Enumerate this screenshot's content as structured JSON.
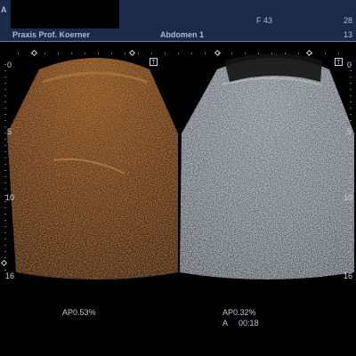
{
  "header": {
    "left_letter": "A",
    "practice": "Praxis Prof. Koerner",
    "exam": "Abdomen 1",
    "freq": "F 43",
    "right_top": "28",
    "right_bottom": "13"
  },
  "scales": {
    "left": [
      "0",
      "5",
      "10",
      "16"
    ],
    "right": [
      "0",
      "5",
      "10",
      "16"
    ]
  },
  "markers": {
    "t_left": "T",
    "t_right": "T"
  },
  "footer": {
    "left_ap": "AP0.53%",
    "right_ap": "AP0.32%",
    "time_label": "A",
    "time_value": "00:18"
  },
  "colors": {
    "header_bg": "#1c2a4a",
    "contrast_image": "#6a3a16",
    "bmode_image": "#9aa0aa"
  }
}
